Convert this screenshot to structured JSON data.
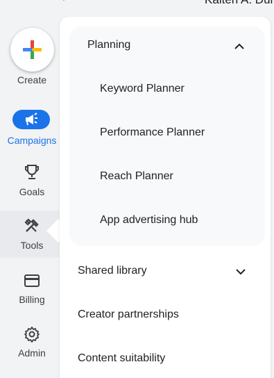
{
  "topbar": {
    "account_name": "Kalten A. Dun",
    "chevron": "⌄"
  },
  "rail": {
    "create_label": "Create",
    "items": [
      {
        "label": "Campaigns",
        "icon": "megaphone-icon",
        "active": true
      },
      {
        "label": "Goals",
        "icon": "trophy-icon"
      },
      {
        "label": "Tools",
        "icon": "tools-icon",
        "selected": true
      },
      {
        "label": "Billing",
        "icon": "credit-card-icon"
      },
      {
        "label": "Admin",
        "icon": "gear-icon"
      }
    ]
  },
  "menu": {
    "planning": {
      "label": "Planning",
      "expanded": true,
      "items": [
        "Keyword Planner",
        "Performance Planner",
        "Reach Planner",
        "App advertising hub"
      ]
    },
    "shared_library": {
      "label": "Shared library",
      "expanded": false
    },
    "creator_partnerships": "Creator partnerships",
    "content_suitability": "Content suitability"
  },
  "colors": {
    "accent": "#1a73e8",
    "rail_bg": "#f1f3f4",
    "group_bg": "#f8f9fa"
  }
}
